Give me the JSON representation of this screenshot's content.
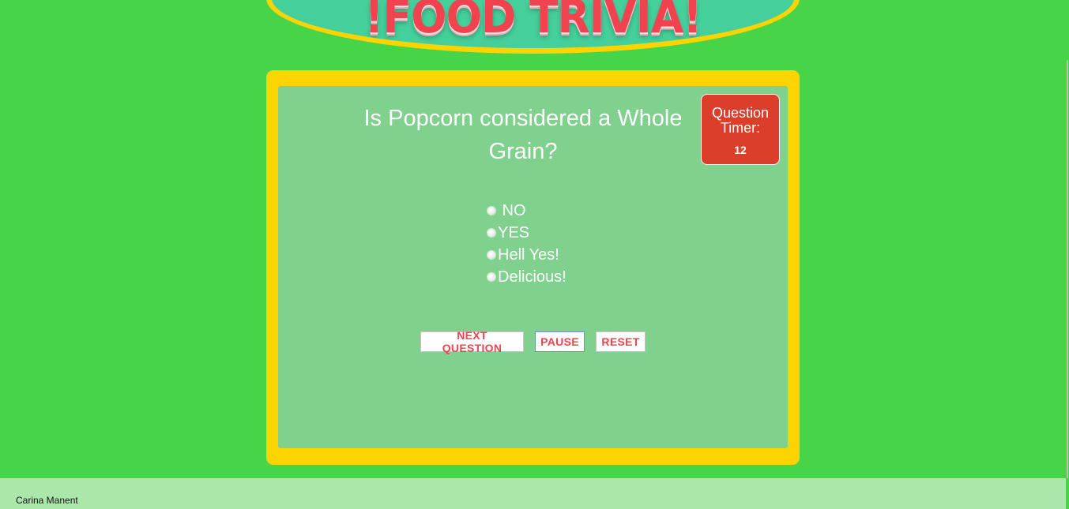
{
  "header": {
    "title": "!FOOD TRIVIA!"
  },
  "question": {
    "text": "Is Popcorn considered a Whole Grain?"
  },
  "timer": {
    "label": "Question Timer:",
    "value": "12"
  },
  "answers": [
    {
      "label": " NO"
    },
    {
      "label": "YES"
    },
    {
      "label": "Hell Yes!"
    },
    {
      "label": "Delicious!"
    }
  ],
  "buttons": {
    "next_label": "NEXT QUESTION",
    "pause_label": "PAUSE",
    "reset_label": "RESET"
  },
  "footer": {
    "credit": "Carina Manent"
  },
  "colors": {
    "background": "#48d448",
    "card_border": "#fdd400",
    "card_fill": "#80d08e",
    "banner_fill": "#44cf9b",
    "accent_red": "#f0434f",
    "timer_red": "#dc3e2c",
    "footer": "#abe7ab"
  }
}
